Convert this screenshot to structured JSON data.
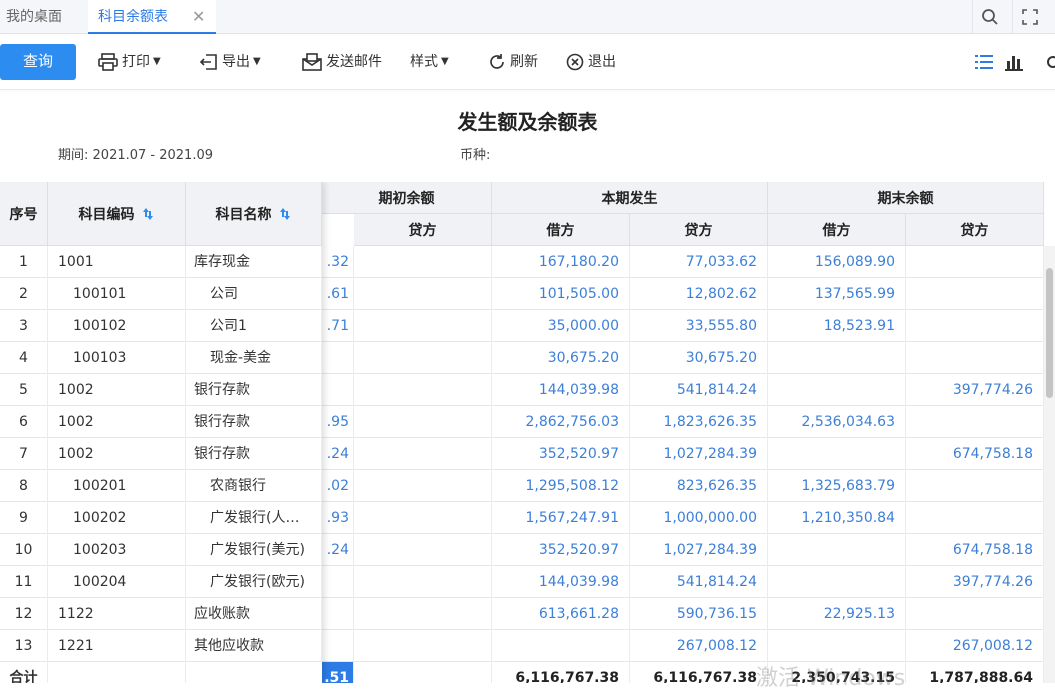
{
  "tabs": {
    "home": "我的桌面",
    "active": "科目余额表",
    "close": "✕"
  },
  "toolbar": {
    "query": "查询",
    "print": "打印",
    "export": "导出",
    "email": "发送邮件",
    "style": "样式",
    "refresh": "刷新",
    "exit": "退出"
  },
  "report": {
    "title": "发生额及余额表",
    "period_label": "期间:",
    "period_value": "2021.07 - 2021.09",
    "currency_label": "币种:"
  },
  "headers": {
    "seq": "序号",
    "code": "科目编码",
    "name": "科目名称",
    "opening": "期初余额",
    "current": "本期发生",
    "closing": "期末余额",
    "debit": "借方",
    "credit": "贷方"
  },
  "rows": [
    {
      "seq": "1",
      "code": "1001",
      "name": "库存现金",
      "ob": ".32",
      "cd": "167,180.20",
      "cc": "77,033.62",
      "ed": "156,089.90",
      "ec": ""
    },
    {
      "seq": "2",
      "code": "100101",
      "name": "公司",
      "ob": ".61",
      "cd": "101,505.00",
      "cc": "12,802.62",
      "ed": "137,565.99",
      "ec": ""
    },
    {
      "seq": "3",
      "code": "100102",
      "name": "公司1",
      "ob": ".71",
      "cd": "35,000.00",
      "cc": "33,555.80",
      "ed": "18,523.91",
      "ec": ""
    },
    {
      "seq": "4",
      "code": "100103",
      "name": "现金-美金",
      "ob": "",
      "cd": "30,675.20",
      "cc": "30,675.20",
      "ed": "",
      "ec": ""
    },
    {
      "seq": "5",
      "code": "1002",
      "name": "银行存款",
      "ob": "",
      "cd": "144,039.98",
      "cc": "541,814.24",
      "ed": "",
      "ec": "397,774.26"
    },
    {
      "seq": "6",
      "code": "1002",
      "name": "银行存款",
      "ob": ".95",
      "cd": "2,862,756.03",
      "cc": "1,823,626.35",
      "ed": "2,536,034.63",
      "ec": ""
    },
    {
      "seq": "7",
      "code": "1002",
      "name": "银行存款",
      "ob": ".24",
      "cd": "352,520.97",
      "cc": "1,027,284.39",
      "ed": "",
      "ec": "674,758.18"
    },
    {
      "seq": "8",
      "code": "100201",
      "name": "农商银行",
      "ob": ".02",
      "cd": "1,295,508.12",
      "cc": "823,626.35",
      "ed": "1,325,683.79",
      "ec": ""
    },
    {
      "seq": "9",
      "code": "100202",
      "name": "广发银行(人…",
      "ob": ".93",
      "cd": "1,567,247.91",
      "cc": "1,000,000.00",
      "ed": "1,210,350.84",
      "ec": ""
    },
    {
      "seq": "10",
      "code": "100203",
      "name": "广发银行(美元)",
      "ob": ".24",
      "cd": "352,520.97",
      "cc": "1,027,284.39",
      "ed": "",
      "ec": "674,758.18"
    },
    {
      "seq": "11",
      "code": "100204",
      "name": "广发银行(欧元)",
      "ob": "",
      "cd": "144,039.98",
      "cc": "541,814.24",
      "ed": "",
      "ec": "397,774.26"
    },
    {
      "seq": "12",
      "code": "1122",
      "name": "应收账款",
      "ob": "",
      "cd": "613,661.28",
      "cc": "590,736.15",
      "ed": "22,925.13",
      "ec": ""
    },
    {
      "seq": "13",
      "code": "1221",
      "name": "其他应收款",
      "ob": "",
      "cd": "",
      "cc": "267,008.12",
      "ed": "",
      "ec": "267,008.12"
    }
  ],
  "totals": {
    "label": "合计",
    "ob": ".51",
    "cd": "6,116,767.38",
    "cc": "6,116,767.38",
    "ed": "2,350,743.15",
    "ec": "1,787,888.64"
  },
  "watermark": "激活 Windows",
  "colors": {
    "accent": "#2d8cf0",
    "number": "#3d7fd8"
  }
}
